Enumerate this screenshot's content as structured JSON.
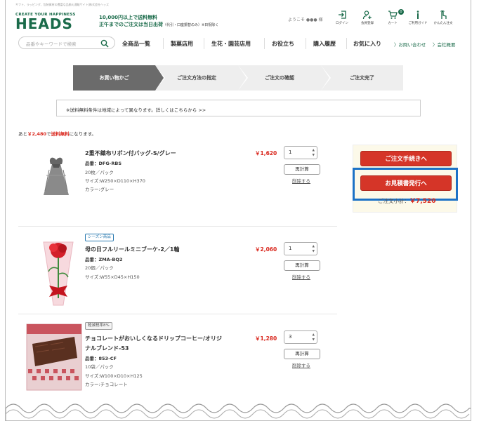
{
  "header": {
    "tagline": "ギフト、ラッピング、包装資材の豊富な品揃え通販サイト|株式会社ヘッズ",
    "logo_sub": "CREATE YOUR HAPPINESS",
    "logo": "HEADS",
    "shipping_line1": "10,000円以上で送料無料",
    "shipping_line2": "正午までのご注文は当日出荷",
    "shipping_note": "（代引・口座振替のみ）※日祝除く",
    "greeting": "ようこそ ●●● 様",
    "icons": [
      {
        "name": "login-icon",
        "label": "ログイン"
      },
      {
        "name": "register-icon",
        "label": "会員登録"
      },
      {
        "name": "cart-icon",
        "label": "カート"
      },
      {
        "name": "guide-icon",
        "label": "ご利用ガイド"
      },
      {
        "name": "easy-order-icon",
        "label": "かんたん注文"
      }
    ],
    "cart_count": "0",
    "search_placeholder": "品番やキーワードで検索"
  },
  "nav": {
    "items": [
      "全商品一覧",
      "製菓店用",
      "生花・園芸店用",
      "お役立ち",
      "購入履歴",
      "お気に入り"
    ],
    "contact": "〉お問い合わせ",
    "company": "〉会社概要"
  },
  "steps": [
    "お買い物かご",
    "ご注文方法の指定",
    "ご注文の確認",
    "ご注文完了"
  ],
  "notice": "※送料無料条件は地域によって異なります。詳しくはこちらから >>",
  "remain": {
    "prefix": "あと",
    "amount": "￥2,480",
    "mid": "で",
    "free": "送料無料",
    "suffix": "になります。"
  },
  "items": [
    {
      "name": "2重不織布リボン付バッグ-S/グレー",
      "code": "品番：DFG-RBS",
      "line1": "20枚／パック",
      "line2": "サイズ:W250×D110×H370",
      "line3": "カラー:グレー",
      "price": "￥1,620",
      "qty": "1",
      "recalc": "再計算",
      "delete": "削除する"
    },
    {
      "tag": "シーズン商品",
      "name": "母の日フルリールミニブーケ-2／1輪",
      "code": "品番：ZMA-BQ2",
      "line1": "20個／パック",
      "line2": "サイズ:W55×D45×H150",
      "price": "￥2,060",
      "qty": "1",
      "recalc": "再計算",
      "delete": "削除する"
    },
    {
      "tag": "軽減税率8%",
      "name": "チョコレートがおいしくなるドリップコーヒー/オリジ",
      "name2": "ナルブレンド-53",
      "code": "品番：853-CF",
      "line1": "10袋／パック",
      "line2": "サイズ:W100×D10×H125",
      "line3": "カラー:チョコレート",
      "price": "￥1,280",
      "qty": "3",
      "recalc": "再計算",
      "delete": "削除する"
    }
  ],
  "side": {
    "checkout": "ご注文手続きへ",
    "estimate": "お見積書発行へ",
    "subtotal_label": "ご注文小計：",
    "subtotal": "￥7,520"
  },
  "colors": {
    "brand": "#1a6b4a",
    "accent": "#d53528",
    "highlight": "#1d72c6"
  }
}
